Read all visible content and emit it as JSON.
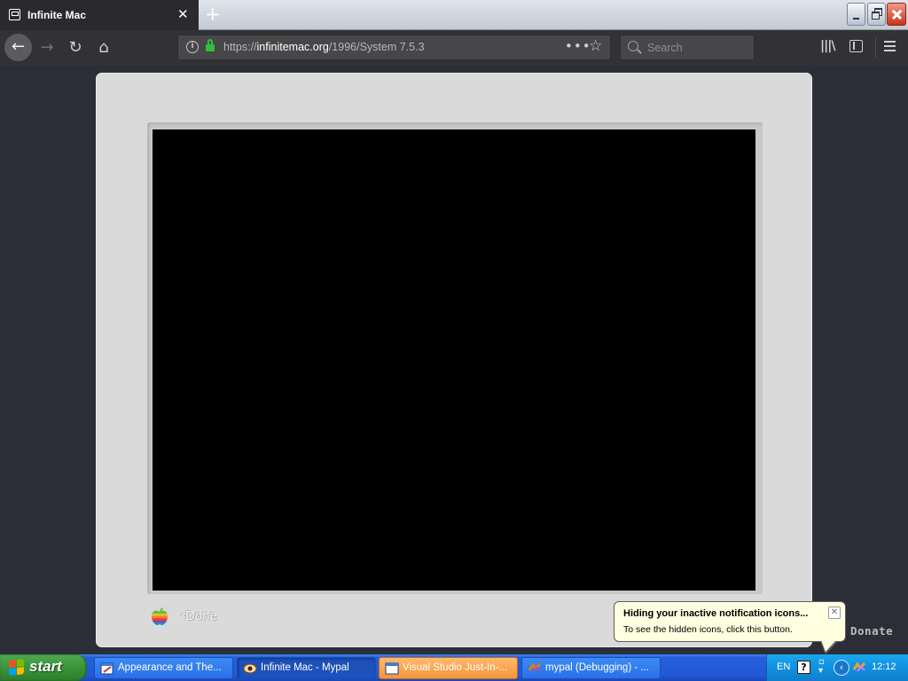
{
  "browser": {
    "tab": {
      "title": "Infinite Mac"
    },
    "url": {
      "prefix": "https://",
      "domain": "infinitemac.org",
      "path": "/1996/System 7.5.3"
    },
    "search": {
      "placeholder": "Search"
    }
  },
  "page": {
    "done_label": "Done",
    "donate_label": "Donate"
  },
  "balloon": {
    "title": "Hiding your inactive notification icons...",
    "body": "To see the hidden icons, click this button."
  },
  "taskbar": {
    "start_label": "start",
    "tasks": [
      {
        "label": "Appearance and The..."
      },
      {
        "label": "Infinite Mac - Mypal"
      },
      {
        "label": "Visual Studio Just-In-..."
      },
      {
        "label": "mypal (Debugging) - ..."
      }
    ],
    "tray": {
      "language": "EN",
      "time": "12:12"
    }
  },
  "colors": {
    "page_background": "#2b2e37",
    "bezel": "#dadada",
    "screen": "#000000",
    "secure_lock": "#30c03a",
    "taskbar_blue": "#245edb",
    "start_green": "#3b933b",
    "tray_blue": "#1290e0",
    "balloon_bg": "#ffffe1",
    "vs_task_orange": "#f5953a"
  }
}
